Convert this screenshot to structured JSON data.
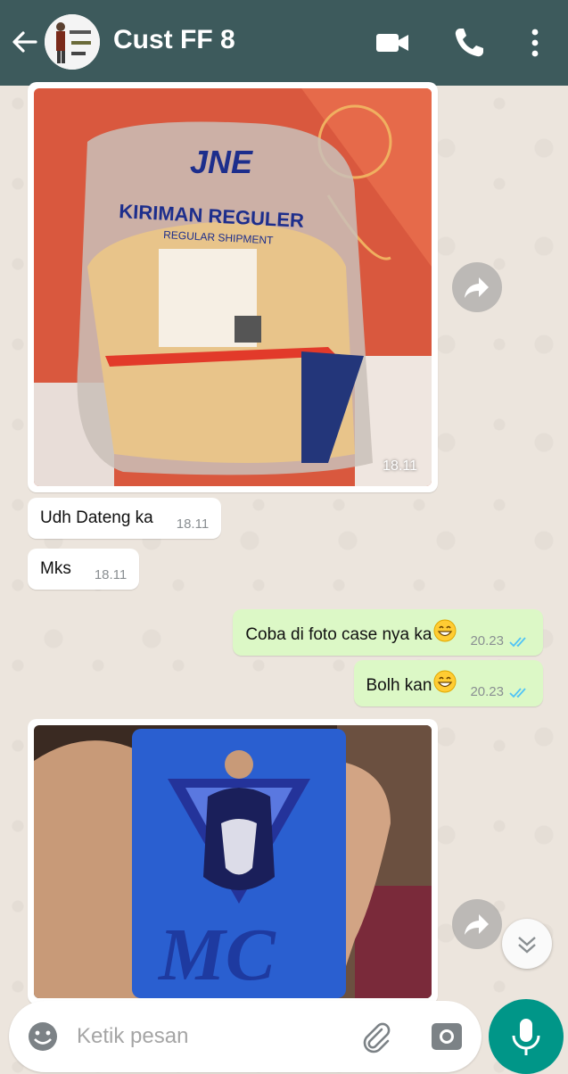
{
  "header": {
    "back_icon": "arrow-left-icon",
    "contact_name": "Cust FF 8",
    "icons": [
      "video-camera-icon",
      "phone-icon",
      "more-vert-icon"
    ]
  },
  "messages": [
    {
      "type": "image",
      "direction": "in",
      "description_icon": "package-photo",
      "time": "18.11",
      "photo_text": [
        "JNE",
        "KIRIMAN REGULER",
        "REGULAR SHIPMENT"
      ]
    },
    {
      "type": "text",
      "direction": "in",
      "text": "Udh Dateng ka",
      "time": "18.11"
    },
    {
      "type": "text",
      "direction": "in",
      "text": "Mks",
      "time": "18.11"
    },
    {
      "type": "text",
      "direction": "out",
      "text": "Coba di foto case nya ka",
      "emoji": "grinning-face-icon",
      "time": "20.23",
      "status": "read"
    },
    {
      "type": "text",
      "direction": "out",
      "text": "Bolh kan",
      "emoji": "grinning-face-icon",
      "time": "20.23",
      "status": "read"
    },
    {
      "type": "image",
      "direction": "in",
      "description_icon": "phone-case-photo",
      "photo_text": [
        "MC"
      ]
    }
  ],
  "composer": {
    "placeholder": "Ketik pesan",
    "icons": [
      "emoji-icon",
      "paperclip-icon",
      "camera-icon",
      "microphone-icon"
    ]
  },
  "colors": {
    "header": "#3d5a5c",
    "outgoing_bubble": "#dcf8c6",
    "incoming_bubble": "#ffffff",
    "read_ticks": "#4fc3f7",
    "mic_button": "#009688"
  }
}
